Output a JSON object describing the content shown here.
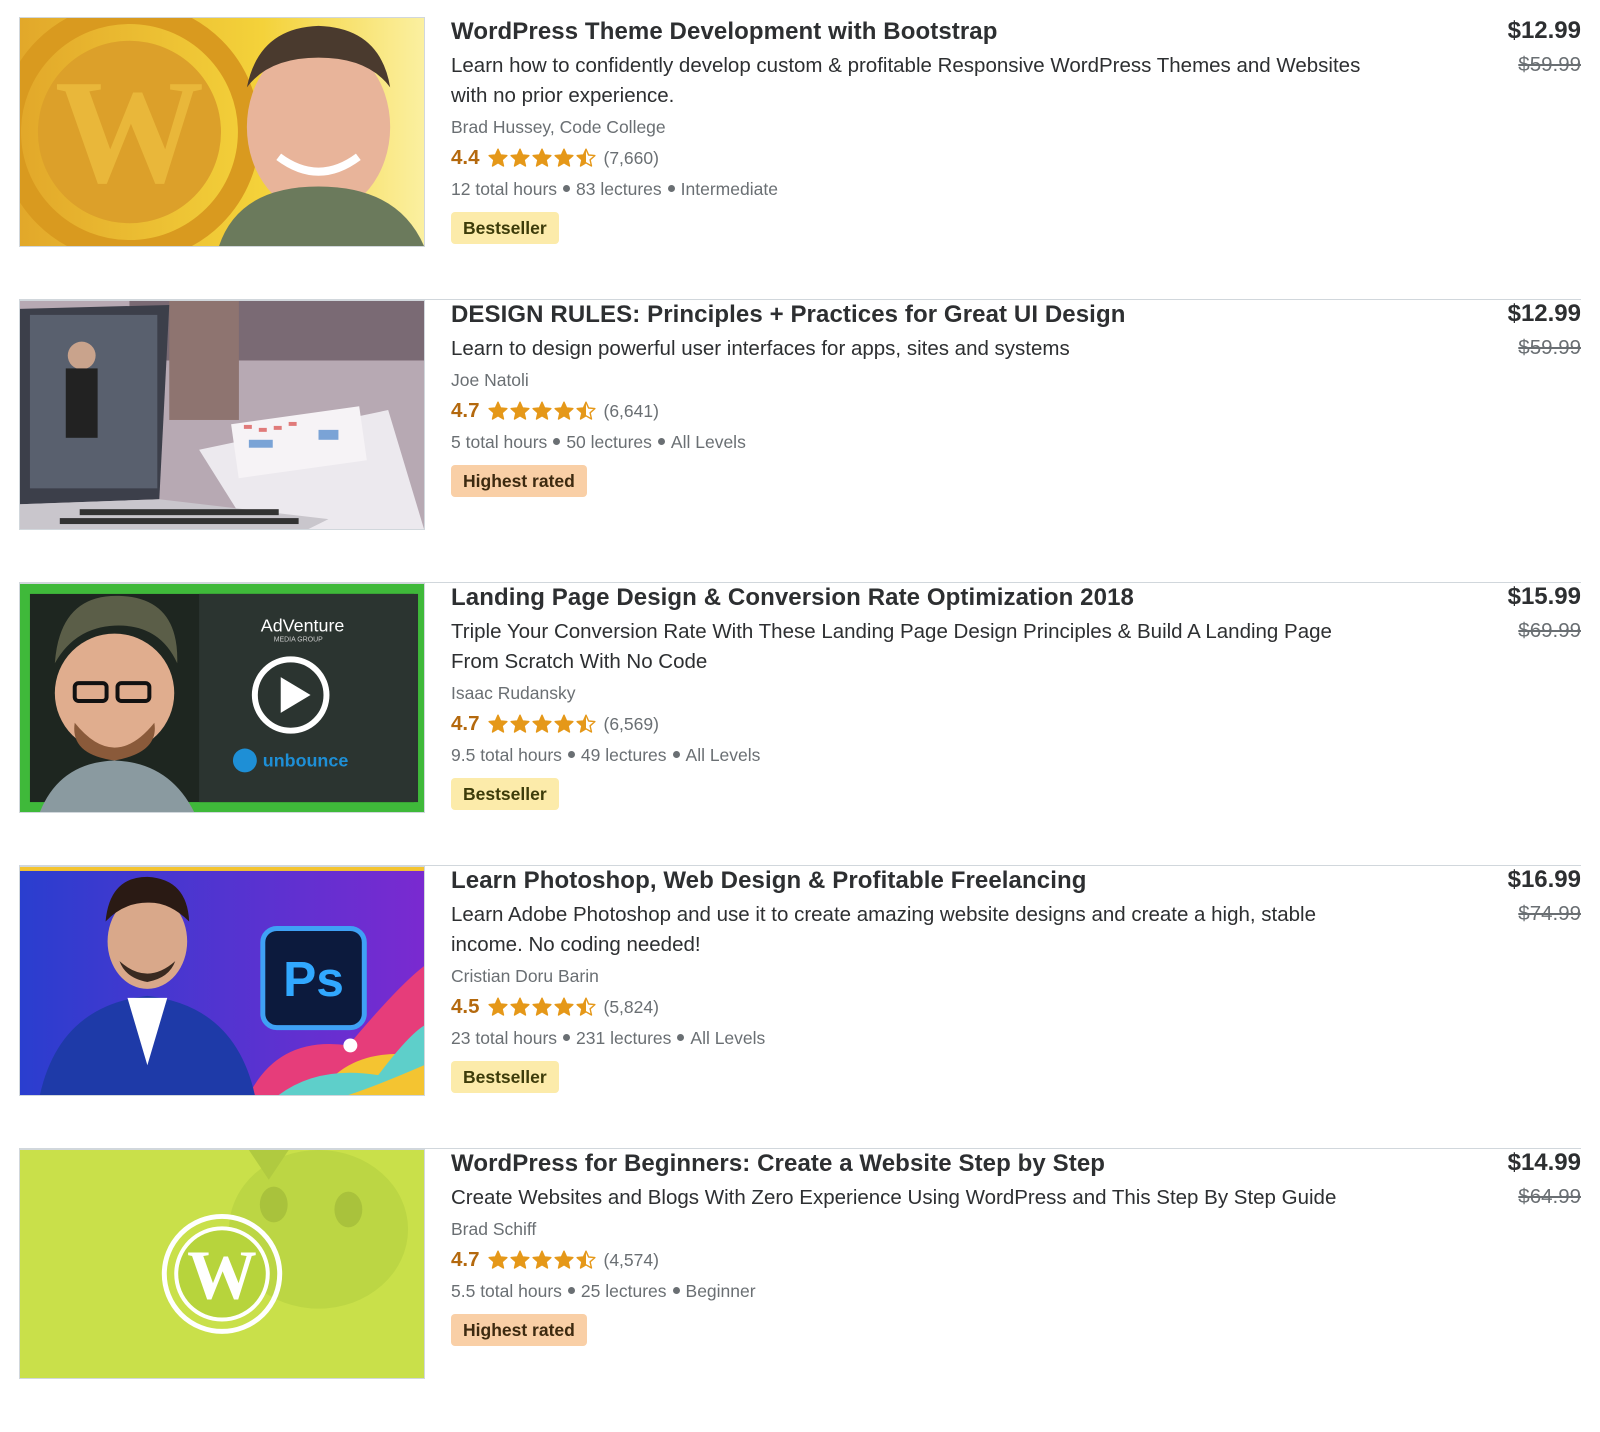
{
  "courses": [
    {
      "title": "WordPress Theme Development with Bootstrap",
      "description": "Learn how to confidently develop custom & profitable Responsive WordPress Themes and Websites with no prior experience.",
      "instructor": "Brad Hussey, Code College",
      "rating": "4.4",
      "stars": 4.4,
      "reviews": "(7,660)",
      "hours": "12 total hours",
      "lectures": "83 lectures",
      "level": "Intermediate",
      "badge": "Bestseller",
      "badge_type": "best",
      "price": "$12.99",
      "old_price": "$59.99",
      "thumb_icon": "wordpress-logo-instructor-photo"
    },
    {
      "title": "DESIGN RULES: Principles + Practices for Great UI Design",
      "description": "Learn to design powerful user interfaces for apps, sites and systems",
      "instructor": "Joe Natoli",
      "rating": "4.7",
      "stars": 4.7,
      "reviews": "(6,641)",
      "hours": "5 total hours",
      "lectures": "50 lectures",
      "level": "All Levels",
      "badge": "Highest rated",
      "badge_type": "high",
      "price": "$12.99",
      "old_price": "$59.99",
      "thumb_icon": "laptop-desk-photo"
    },
    {
      "title": "Landing Page Design & Conversion Rate Optimization 2018",
      "description": "Triple Your Conversion Rate With These Landing Page Design Principles & Build A Landing Page From Scratch With No Code",
      "instructor": "Isaac Rudansky",
      "rating": "4.7",
      "stars": 4.7,
      "reviews": "(6,569)",
      "hours": "9.5 total hours",
      "lectures": "49 lectures",
      "level": "All Levels",
      "badge": "Bestseller",
      "badge_type": "best",
      "price": "$15.99",
      "old_price": "$69.99",
      "thumb_icon": "play-video-thumbnail",
      "thumb_text": {
        "brand_top": "AdVenture",
        "brand_sub": "MEDIA GROUP",
        "brand_bottom": "unbounce"
      }
    },
    {
      "title": "Learn Photoshop, Web Design & Profitable Freelancing",
      "description": "Learn Adobe Photoshop and use it to create amazing website designs and create a high, stable income. No coding needed!",
      "instructor": "Cristian Doru Barin",
      "rating": "4.5",
      "stars": 4.5,
      "reviews": "(5,824)",
      "hours": "23 total hours",
      "lectures": "231 lectures",
      "level": "All Levels",
      "badge": "Bestseller",
      "badge_type": "best",
      "price": "$16.99",
      "old_price": "$74.99",
      "thumb_icon": "photoshop-logo-instructor-photo",
      "thumb_text": {
        "ps": "Ps"
      }
    },
    {
      "title": "WordPress for Beginners: Create a Website Step by Step",
      "description": "Create Websites and Blogs With Zero Experience Using WordPress and This Step By Step Guide",
      "instructor": "Brad Schiff",
      "rating": "4.7",
      "stars": 4.7,
      "reviews": "(4,574)",
      "hours": "5.5 total hours",
      "lectures": "25 lectures",
      "level": "Beginner",
      "badge": "Highest rated",
      "badge_type": "high",
      "price": "$14.99",
      "old_price": "$64.99",
      "thumb_icon": "wordpress-logo-cat-photo"
    }
  ],
  "colors": {
    "rating": "#b4690e",
    "star": "#e59819",
    "bestseller_badge": "#fcebaa",
    "highest_rated_badge": "#f9cfa6"
  }
}
